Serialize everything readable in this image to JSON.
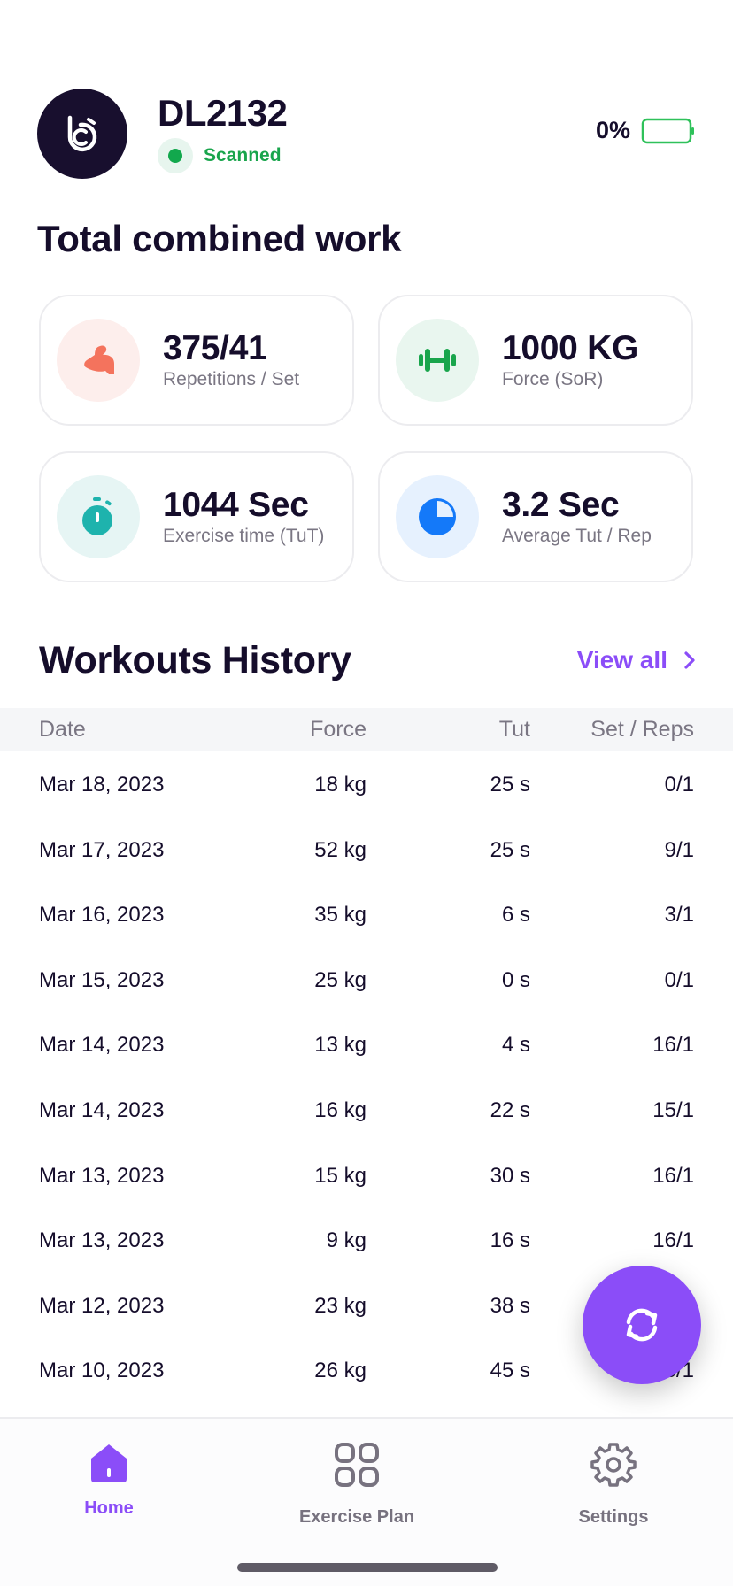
{
  "header": {
    "device_name": "DL2132",
    "status": "Scanned",
    "battery_percent": "0%"
  },
  "summary": {
    "title": "Total combined work",
    "cards": [
      {
        "icon": "flexed-bicep-icon",
        "value": "375/41",
        "label": "Repetitions / Set",
        "color": "#f4735d",
        "bg": "#fdeeec"
      },
      {
        "icon": "dumbbell-icon",
        "value": "1000 KG",
        "label": "Force (SoR)",
        "color": "#19a54c",
        "bg": "#e9f6ef"
      },
      {
        "icon": "stopwatch-icon",
        "value": "1044 Sec",
        "label": "Exercise time (TuT)",
        "color": "#1eb3ad",
        "bg": "#e6f5f4"
      },
      {
        "icon": "pie-chart-icon",
        "value": "3.2 Sec",
        "label": "Average Tut / Rep",
        "color": "#1479f9",
        "bg": "#e6f1fe"
      }
    ]
  },
  "workouts": {
    "title": "Workouts History",
    "view_all": "View all",
    "columns": [
      "Date",
      "Force",
      "Tut",
      "Set / Reps"
    ],
    "rows": [
      {
        "date": "Mar 18, 2023",
        "force": "18 kg",
        "tut": "25 s",
        "sets": "0/1"
      },
      {
        "date": "Mar 17, 2023",
        "force": "52 kg",
        "tut": "25 s",
        "sets": "9/1"
      },
      {
        "date": "Mar 16, 2023",
        "force": "35 kg",
        "tut": "6 s",
        "sets": "3/1"
      },
      {
        "date": "Mar 15, 2023",
        "force": "25 kg",
        "tut": "0 s",
        "sets": "0/1"
      },
      {
        "date": "Mar 14, 2023",
        "force": "13 kg",
        "tut": "4 s",
        "sets": "16/1"
      },
      {
        "date": "Mar 14, 2023",
        "force": "16 kg",
        "tut": "22 s",
        "sets": "15/1"
      },
      {
        "date": "Mar 13, 2023",
        "force": "15 kg",
        "tut": "30 s",
        "sets": "16/1"
      },
      {
        "date": "Mar 13, 2023",
        "force": "9 kg",
        "tut": "16 s",
        "sets": "16/1"
      },
      {
        "date": "Mar 12, 2023",
        "force": "23 kg",
        "tut": "38 s",
        "sets": ""
      },
      {
        "date": "Mar 10, 2023",
        "force": "26 kg",
        "tut": "45 s",
        "sets": "6/1"
      }
    ]
  },
  "fab": {
    "icon": "sync-icon"
  },
  "nav": {
    "items": [
      {
        "label": "Home",
        "icon": "home-icon",
        "active": true
      },
      {
        "label": "Exercise Plan",
        "icon": "grid-icon",
        "active": false
      },
      {
        "label": "Settings",
        "icon": "gear-icon",
        "active": false
      }
    ]
  },
  "colors": {
    "accent": "#8b4df8",
    "text": "#150d2b",
    "muted": "#7a7683",
    "success": "#19a54c"
  }
}
